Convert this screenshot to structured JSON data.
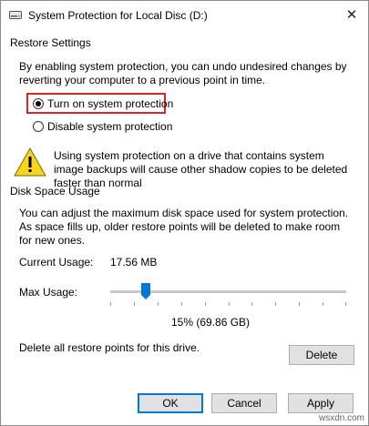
{
  "window": {
    "title": "System Protection for Local Disc (D:)",
    "close_glyph": "✕"
  },
  "restore": {
    "group_label": "Restore Settings",
    "description": "By enabling system protection, you can undo undesired changes by reverting your computer to a previous point in time.",
    "option_on": "Turn on system protection",
    "option_off": "Disable system protection",
    "selected": "on",
    "warning": "Using system protection on a drive that contains system image backups will cause other shadow copies to be deleted faster than normal"
  },
  "disk": {
    "group_label": "Disk Space Usage",
    "description": "You can adjust the maximum disk space used for system protection. As space fills up, older restore points will be deleted to make room for new ones.",
    "current_label": "Current Usage:",
    "current_value": "17.56 MB",
    "max_label": "Max Usage:",
    "max_percent": 15,
    "max_text": "15% (69.86 GB)",
    "delete_text": "Delete all restore points for this drive.",
    "delete_button": "Delete"
  },
  "buttons": {
    "ok": "OK",
    "cancel": "Cancel",
    "apply": "Apply"
  },
  "watermark": "wsxdn.com",
  "colors": {
    "highlight": "#d6262c",
    "accent": "#0078d7",
    "warning": "#f7d51d"
  },
  "icons": {
    "title": "drive-icon",
    "warning": "warning-icon",
    "close": "close-icon"
  }
}
